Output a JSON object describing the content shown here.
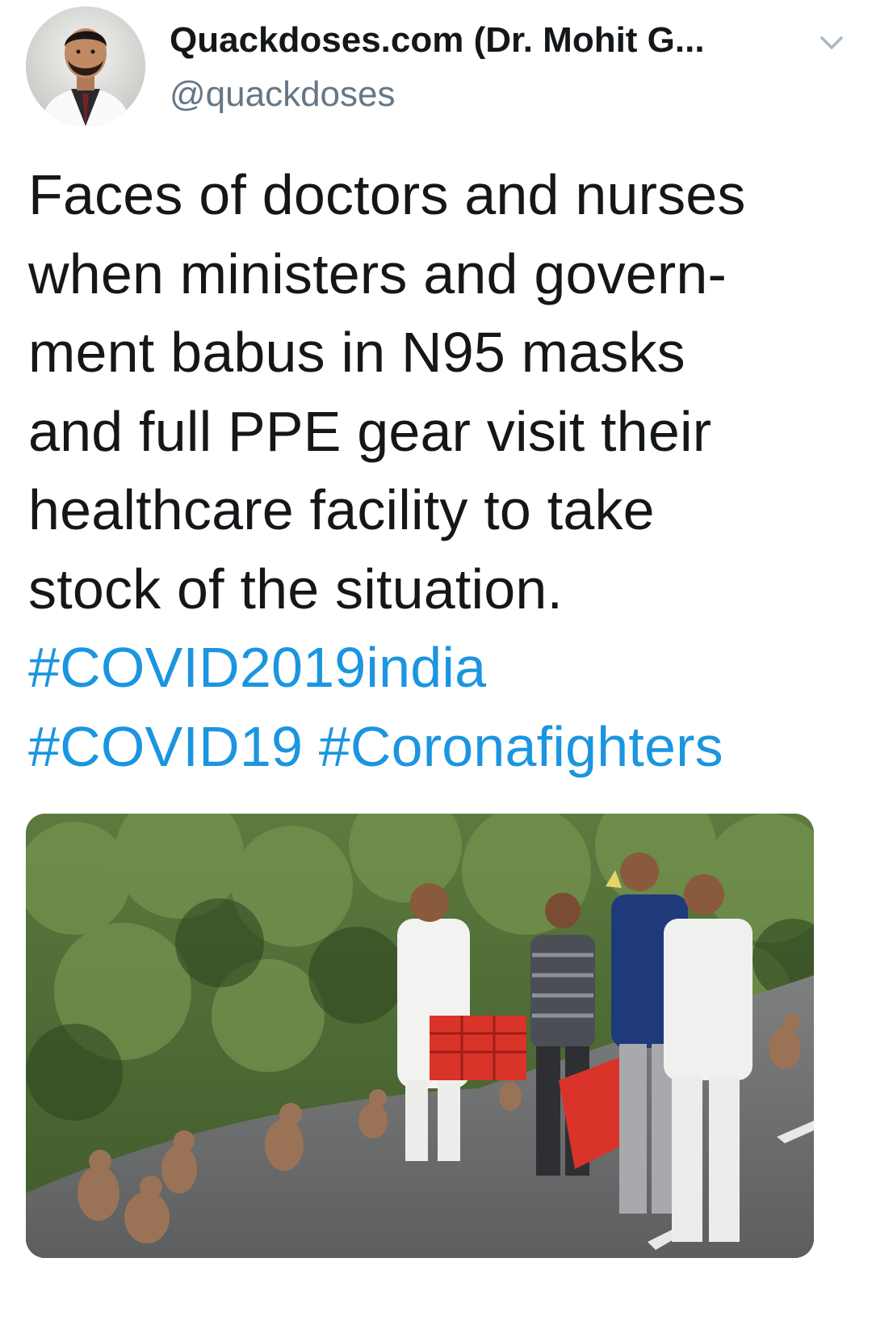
{
  "author": {
    "display_name": "Quackdoses.com (Dr. Mohit G...",
    "handle": "@quackdoses",
    "avatar_icon": "doctor-profile-photo"
  },
  "menu": {
    "icon": "chevron-down-icon",
    "color": "#aab8c2"
  },
  "tweet": {
    "lines": [
      "Faces of doctors and nurses",
      "when ministers and govern-",
      "ment babus in N95 masks",
      "and full PPE gear visit their",
      "healthcare facility to take",
      "stock of the situation."
    ],
    "hashtags": [
      "#COVID2019india",
      "#COVID19",
      "#Coronafighters"
    ]
  },
  "media": {
    "icon": "photo-men-feeding-monkeys",
    "text_color": "#14171a",
    "link_color": "#1b95e0"
  }
}
